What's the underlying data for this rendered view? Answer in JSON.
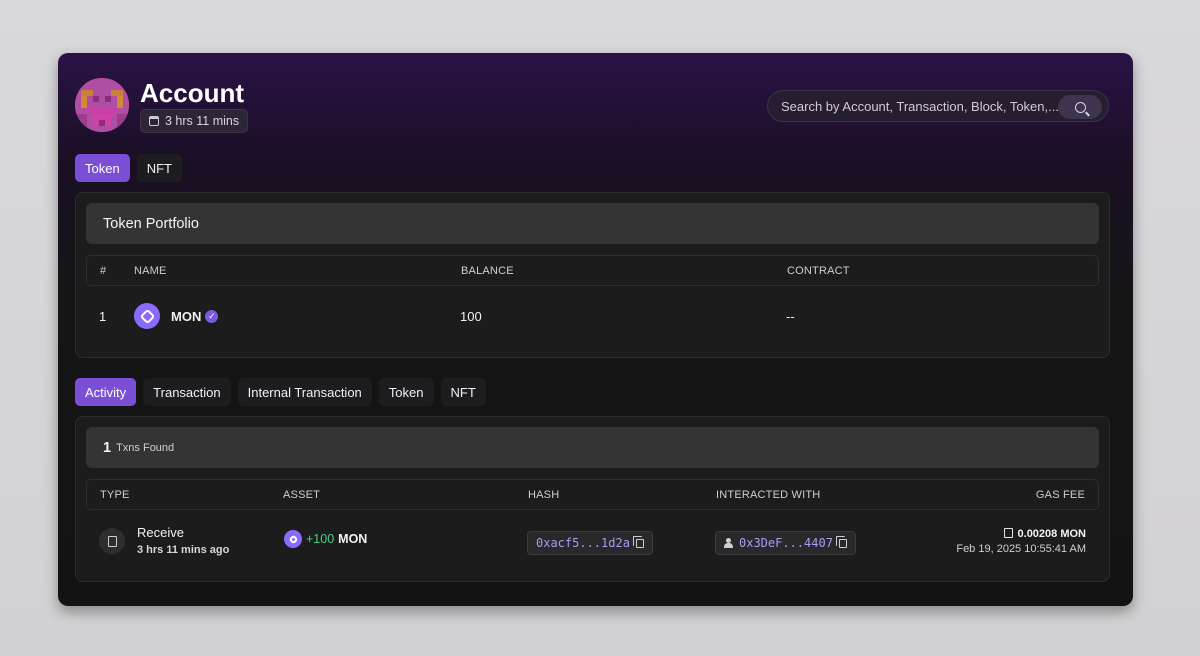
{
  "header": {
    "title": "Account",
    "age": "3 hrs 11 mins",
    "search_placeholder": "Search by Account, Transaction, Block, Token,..."
  },
  "asset_tabs": [
    {
      "label": "Token",
      "active": true
    },
    {
      "label": "NFT",
      "active": false
    }
  ],
  "portfolio": {
    "title": "Token Portfolio",
    "columns": [
      "#",
      "NAME",
      "BALANCE",
      "CONTRACT"
    ],
    "rows": [
      {
        "index": "1",
        "name": "MON",
        "verified": true,
        "balance": "100",
        "contract": "--"
      }
    ]
  },
  "activity_tabs": [
    {
      "label": "Activity",
      "active": true
    },
    {
      "label": "Transaction",
      "active": false
    },
    {
      "label": "Internal Transaction",
      "active": false
    },
    {
      "label": "Token",
      "active": false
    },
    {
      "label": "NFT",
      "active": false
    }
  ],
  "activity": {
    "count": "1",
    "count_label": "Txns Found",
    "columns": [
      "TYPE",
      "ASSET",
      "HASH",
      "INTERACTED WITH",
      "GAS FEE"
    ],
    "rows": [
      {
        "type": "Receive",
        "age": "3 hrs 11 mins ago",
        "amount": "+100",
        "asset": "MON",
        "hash": "0xacf5...1d2a",
        "interacted_with": "0x3DeF...4407",
        "gas_fee": "0.00208 MON",
        "timestamp": "Feb 19, 2025 10:55:41 AM"
      }
    ]
  },
  "colors": {
    "accent": "#7a4fd6",
    "positive": "#4cd08a",
    "hash_text": "#a99cf0"
  }
}
